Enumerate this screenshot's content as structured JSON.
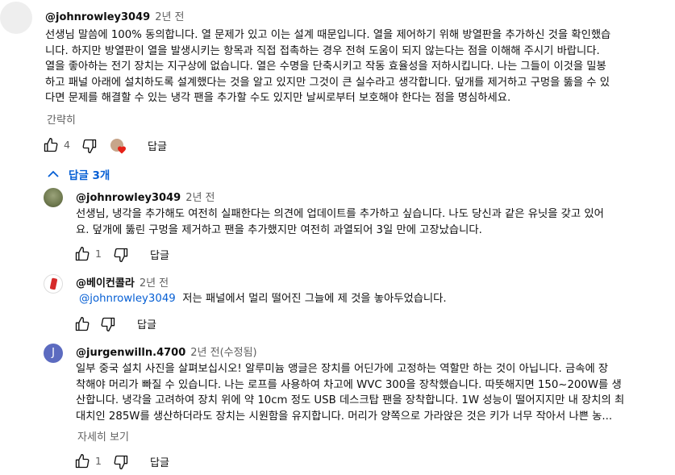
{
  "colors": {
    "link": "#065fd4",
    "muted": "#606060",
    "heart": "#e62117",
    "avatar_j": "#5c6bc0"
  },
  "main_comment": {
    "author": "@johnrowley3049",
    "time": "2년 전",
    "lines": [
      "선생님 말씀에 100% 동의합니다. 열 문제가 있고 이는 설계 때문입니다. 열을 제어하기 위해 방열판을 추가하신 것을 확인했습",
      "니다. 하지만 방열판이 열을 발생시키는 항목과 직접 접촉하는 경우 전혀 도움이 되지 않는다는 점을 이해해 주시기 바랍니다.",
      "열을 좋아하는 전기 장치는 지구상에 없습니다. 열은 수명을 단축시키고 작동 효율성을 저하시킵니다. 나는 그들이 이것을 밀봉",
      "하고 패널 아래에 설치하도록 설계했다는 것을 알고 있지만 그것이 큰 실수라고 생각합니다. 덮개를 제거하고 구멍을 뚫을 수 있",
      "다면 문제를 해결할 수 있는 냉각 팬을 추가할 수도 있지만 날씨로부터 보호해야 한다는 점을 명심하세요."
    ],
    "show_less": "간략히",
    "likes": "4",
    "reply_label": "답글"
  },
  "replies_toggle": "답글 3개",
  "replies": [
    {
      "author": "@johnrowley3049",
      "time": "2년 전",
      "lines": [
        "선생님, 냉각을 추가해도 여전히 실패한다는 의견에 업데이트를 추가하고 싶습니다. 나도 당신과 같은 유닛을 갖고 있어",
        "요. 덮개에 뚫린 구멍을 제거하고 팬을 추가했지만 여전히 과열되어 3일 만에 고장났습니다."
      ],
      "likes": "1",
      "reply_label": "답글"
    },
    {
      "author": "@베이컨콜라",
      "time": "2년 전",
      "mention": "@johnrowley3049",
      "text": "저는 패널에서 멀리 떨어진 그늘에 제 것을 놓아두었습니다.",
      "likes": "",
      "reply_label": "답글"
    },
    {
      "author": "@jurgenwilln.4700",
      "time": "2년 전(수정됨)",
      "avatar_letter": "J",
      "lines": [
        "일부 중국 설치 사진을 살펴보십시오! 알루미늄 앵글은 장치를 어딘가에 고정하는 역할만 하는 것이 아닙니다. 금속에 장",
        "착해야 머리가 빠질 수 있습니다. 나는 로프를 사용하여 차고에 WVC 300을 장착했습니다. 따뜻해지면 150~200W를 생",
        "산합니다. 냉각을 고려하여 장치 위에 약 10cm 정도 USB 데스크탑 팬을 장착합니다. 1W 성능이 떨어지지만 내 장치의 최",
        "대치인 285W를 생산하더라도 장치는 시원함을 유지합니다. 머리가 양쪽으로 가라앉은 것은 키가 너무 작아서 나쁜 농..."
      ],
      "read_more": "자세히 보기",
      "likes": "1",
      "reply_label": "답글"
    }
  ]
}
